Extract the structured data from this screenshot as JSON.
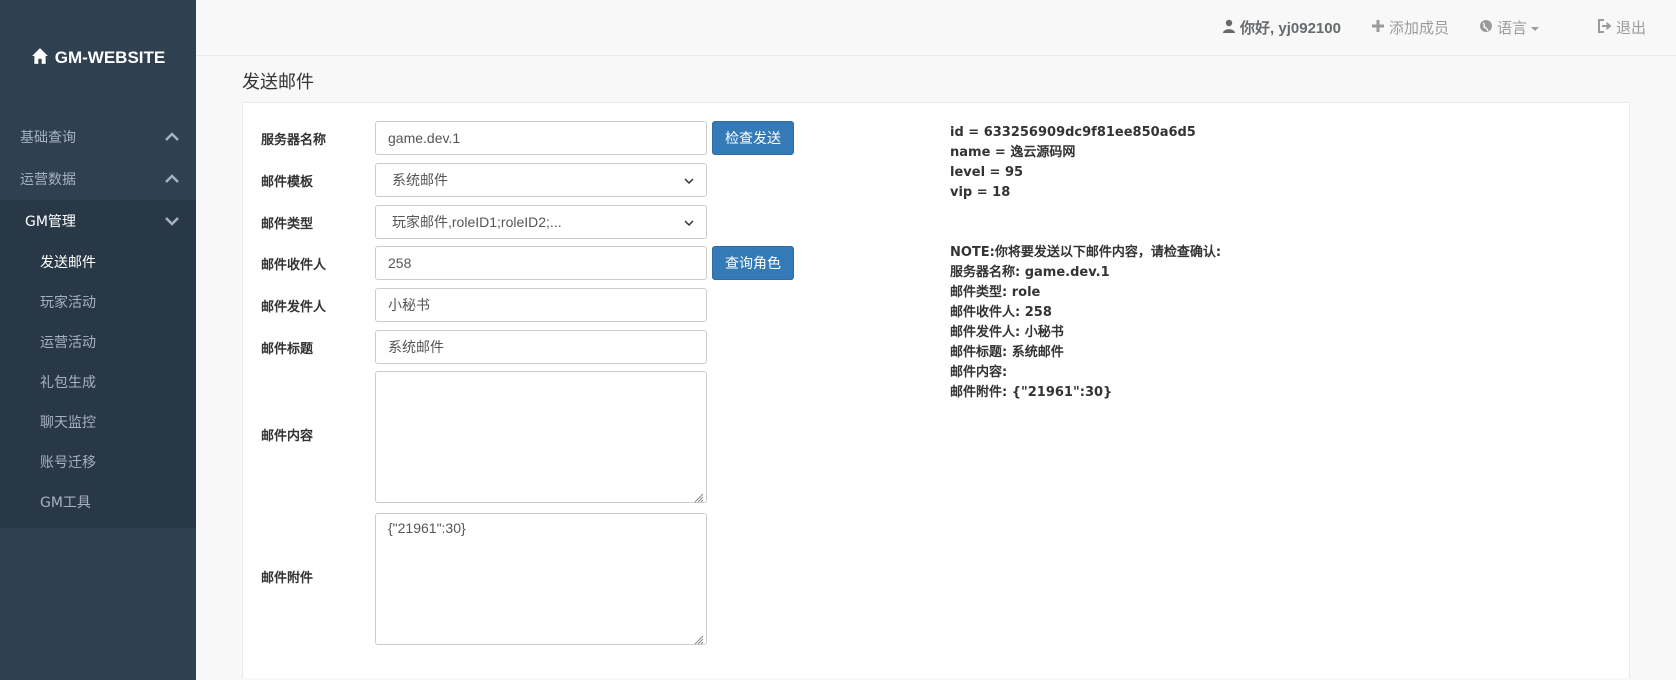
{
  "brand": {
    "title": "GM-WEBSITE",
    "icon": "home-icon"
  },
  "sidebar": {
    "sections": [
      {
        "label": "基础查询",
        "chevron": "chevron-up-icon"
      },
      {
        "label": "运营数据",
        "chevron": "chevron-up-icon"
      },
      {
        "label": "GM管理",
        "chevron": "chevron-down-icon"
      }
    ],
    "sub_items": [
      "发送邮件",
      "玩家活动",
      "运营活动",
      "礼包生成",
      "聊天监控",
      "账号迁移",
      "GM工具"
    ]
  },
  "topbar": {
    "user": "你好, yj092100",
    "add_member": "添加成员",
    "language": "语言",
    "logout": "退出"
  },
  "page": {
    "title": "发送邮件"
  },
  "form": {
    "server_label": "服务器名称",
    "server_value": "game.dev.1",
    "check_send_button": "检查发送",
    "template_label": "邮件模板",
    "template_value": "系统邮件",
    "type_label": "邮件类型",
    "type_value": "玩家邮件,roleID1;roleID2;...",
    "recipient_label": "邮件收件人",
    "recipient_value": "258",
    "query_role_button": "查询角色",
    "sender_label": "邮件发件人",
    "sender_value": "小秘书",
    "subject_label": "邮件标题",
    "subject_value": "系统邮件",
    "content_label": "邮件内容",
    "content_value": "",
    "attachment_label": "邮件附件",
    "attachment_value": "{\"21961\":30}"
  },
  "role_info": {
    "id": "id = 633256909dc9f81ee850a6d5",
    "name": "name = 逸云源码网",
    "level": "level = 95",
    "vip": "vip = 18"
  },
  "confirm": {
    "note": "NOTE:你将要发送以下邮件内容，请检查确认:",
    "server": "服务器名称: game.dev.1",
    "type": "邮件类型: role",
    "recipient": "邮件收件人: 258",
    "sender": "邮件发件人: 小秘书",
    "subject": "邮件标题: 系统邮件",
    "content": "邮件内容:",
    "attachment": "邮件附件: {\"21961\":30}"
  },
  "colors": {
    "sidebar_bg": "#2f4050",
    "primary_button": "#337ab7"
  }
}
